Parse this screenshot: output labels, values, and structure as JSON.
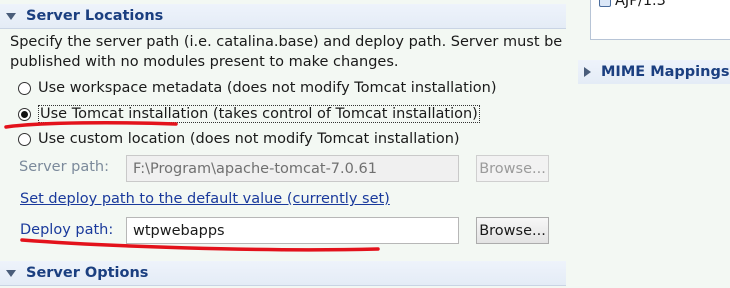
{
  "server_locations": {
    "title": "Server Locations",
    "description_line1": "Specify the server path (i.e. catalina.base) and deploy path. Server must be",
    "description_line2": "published with no modules present to make changes.",
    "options": [
      {
        "label": "Use workspace metadata (does not modify Tomcat installation)",
        "selected": false
      },
      {
        "label": "Use Tomcat installation (takes control of Tomcat installation)",
        "selected": true
      },
      {
        "label": "Use custom location (does not modify Tomcat installation)",
        "selected": false
      }
    ],
    "server_path_label": "Server path:",
    "server_path_value": "F:\\Program\\apache-tomcat-7.0.61",
    "browse_label": "Browse...",
    "set_default_link": "Set deploy path to the default value (currently set)",
    "deploy_path_label": "Deploy path:",
    "deploy_path_value": "wtpwebapps"
  },
  "server_options": {
    "title": "Server Options"
  },
  "right_panel": {
    "connector_item": "AJP/1.3",
    "mime_mappings_title": "MIME Mappings"
  },
  "colors": {
    "header_text": "#1b3f80",
    "annotation_red": "#e3121b",
    "link": "#1a3a9c"
  }
}
